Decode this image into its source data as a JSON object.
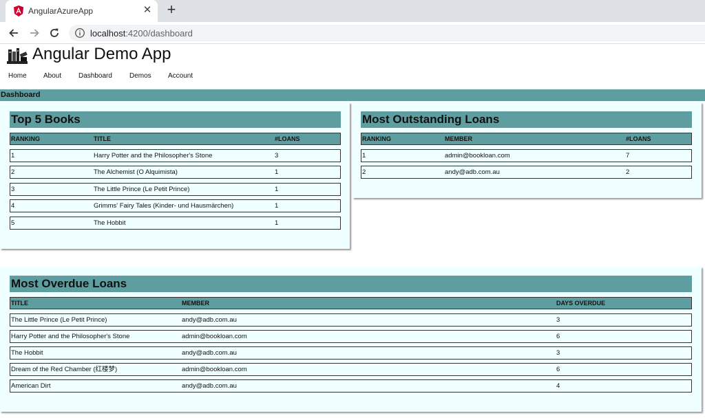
{
  "browser": {
    "tab_title": "AngularAzureApp",
    "tab_close": "✕",
    "new_tab": "+",
    "url_host": "localhost",
    "url_path": ":4200/dashboard"
  },
  "app": {
    "title": "Angular Demo App",
    "nav": [
      "Home",
      "About",
      "Dashboard",
      "Demos",
      "Account"
    ],
    "section": "Dashboard"
  },
  "top_books": {
    "title": "Top 5 Books",
    "headers": [
      "RANKING",
      "TITLE",
      "#LOANS"
    ],
    "rows": [
      [
        "1",
        "Harry Potter and the Philosopher's Stone",
        "3"
      ],
      [
        "2",
        "The Alchemist (O Alquimista)",
        "1"
      ],
      [
        "3",
        "The Little Prince (Le Petit Prince)",
        "1"
      ],
      [
        "4",
        "Grimms' Fairy Tales (Kinder- und Hausmärchen)",
        "1"
      ],
      [
        "5",
        "The Hobbit",
        "1"
      ]
    ]
  },
  "outstanding": {
    "title": "Most Outstanding Loans",
    "headers": [
      "RANKING",
      "MEMBER",
      "#LOANS"
    ],
    "rows": [
      [
        "1",
        "admin@bookloan.com",
        "7"
      ],
      [
        "2",
        "andy@adb.com.au",
        "2"
      ]
    ]
  },
  "overdue": {
    "title": "Most Overdue Loans",
    "headers": [
      "TITLE",
      "MEMBER",
      "DAYS OVERDUE"
    ],
    "rows": [
      [
        "The Little Prince (Le Petit Prince)",
        "andy@adb.com.au",
        "3"
      ],
      [
        "Harry Potter and the Philosopher's Stone",
        "admin@bookloan.com",
        "6"
      ],
      [
        "The Hobbit",
        "andy@adb.com.au",
        "3"
      ],
      [
        "Dream of the Red Chamber (红楼梦)",
        "admin@bookloan.com",
        "6"
      ],
      [
        "American Dirt",
        "andy@adb.com.au",
        "4"
      ]
    ]
  },
  "colors": {
    "accent": "#5f9ea0",
    "card_bg": "#f0ffff"
  },
  "icons": [
    "angular-logo-icon",
    "close-icon",
    "plus-icon",
    "back-arrow-icon",
    "forward-arrow-icon",
    "reload-icon",
    "info-icon",
    "books-logo-icon"
  ]
}
